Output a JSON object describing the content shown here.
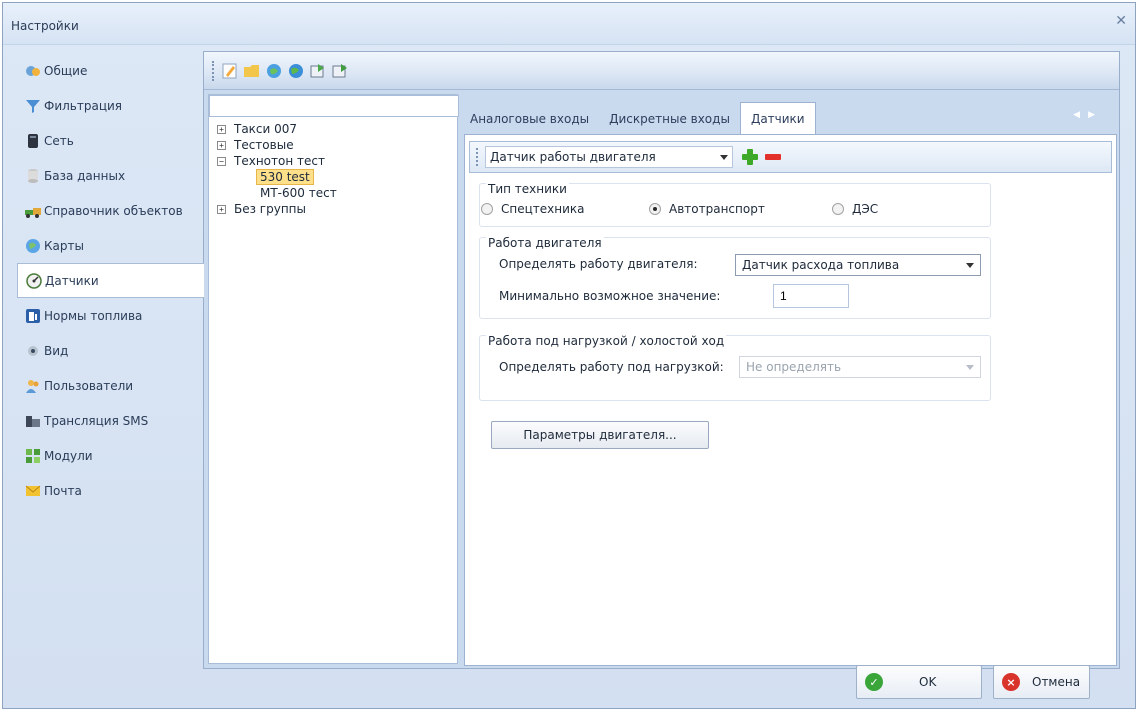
{
  "window": {
    "title": "Настройки"
  },
  "nav": {
    "items": [
      {
        "label": "Общие",
        "icon": "general-icon"
      },
      {
        "label": "Фильтрация",
        "icon": "filter-icon"
      },
      {
        "label": "Сеть",
        "icon": "network-icon"
      },
      {
        "label": "База данных",
        "icon": "database-icon"
      },
      {
        "label": "Справочник объектов",
        "icon": "objects-directory-icon"
      },
      {
        "label": "Карты",
        "icon": "maps-icon"
      },
      {
        "label": "Датчики",
        "icon": "sensors-icon"
      },
      {
        "label": "Нормы топлива",
        "icon": "fuel-norms-icon"
      },
      {
        "label": "Вид",
        "icon": "view-icon"
      },
      {
        "label": "Пользователи",
        "icon": "users-icon"
      },
      {
        "label": "Трансляция SMS",
        "icon": "sms-icon"
      },
      {
        "label": "Модули",
        "icon": "modules-icon"
      },
      {
        "label": "Почта",
        "icon": "mail-icon"
      }
    ],
    "active_index": 6
  },
  "tree": {
    "search_value": "",
    "nodes": [
      {
        "label": "Такси 007",
        "expander": "+"
      },
      {
        "label": "Тестовые",
        "expander": "+"
      },
      {
        "label": "Технотон тест",
        "expander": "−"
      },
      {
        "label": "530 test",
        "child": true,
        "selected": true
      },
      {
        "label": "МТ-600 тест",
        "child": true
      },
      {
        "label": "Без группы",
        "expander": "+"
      }
    ]
  },
  "tabs": {
    "items": [
      "Аналоговые входы",
      "Дискретные входы",
      "Датчики"
    ],
    "active": "Датчики"
  },
  "sensor": {
    "selected": "Датчик работы двигателя"
  },
  "vehicle_type": {
    "title": "Тип техники",
    "options": [
      "Спецтехника",
      "Автотранспорт",
      "ДЭС"
    ],
    "selected": "Автотранспорт"
  },
  "engine_work": {
    "title": "Работа двигателя",
    "detect_label": "Определять работу двигателя:",
    "detect_value": "Датчик расхода топлива",
    "min_label": "Минимально возможное значение:",
    "min_value": "1"
  },
  "load_work": {
    "title": "Работа под нагрузкой / холостой ход",
    "detect_label": "Определять работу под нагрузкой:",
    "detect_value": "Не определять"
  },
  "engine_params_button": "Параметры двигателя...",
  "footer": {
    "ok_label": "OK",
    "cancel_label": "Отмена"
  },
  "colors": {
    "window_bg": "#d3e0f1",
    "selection": "#ffe08a",
    "ok_green": "#3aa63a",
    "cancel_red": "#d9342b"
  }
}
